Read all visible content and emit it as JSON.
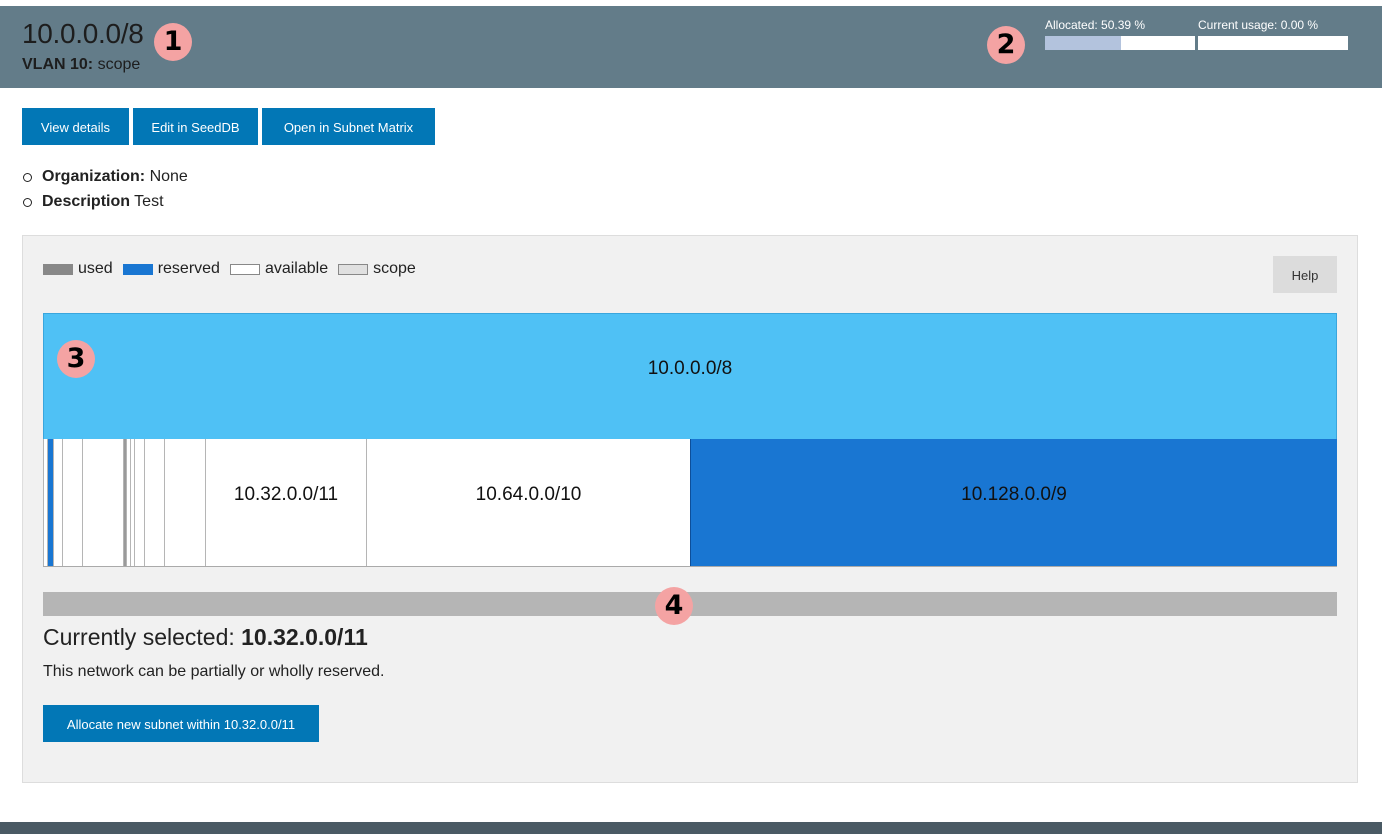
{
  "header": {
    "title": "10.0.0.0/8",
    "vlan_label": "VLAN 10:",
    "vlan_value": "scope",
    "allocated_label": "Allocated: 50.39 %",
    "allocated_fraction": 0.5039,
    "usage_label": "Current usage: 0.00 %",
    "usage_fraction": 0.0,
    "allocated_color": "#b3c3dd",
    "header_color": "#637c89"
  },
  "markers": [
    "1",
    "2",
    "3",
    "4"
  ],
  "actions": {
    "view_details": "View details",
    "edit_seeddb": "Edit in SeedDB",
    "open_matrix": "Open in Subnet Matrix"
  },
  "info": {
    "org_label": "Organization:",
    "org_value": "None",
    "desc_label": "Description",
    "desc_value": "Test"
  },
  "legend": {
    "used": "used",
    "reserved": "reserved",
    "available": "available",
    "scope": "scope",
    "colors": {
      "used": "#888888",
      "reserved": "#1976d2",
      "available": "#ffffff",
      "scope": "#e0e0e0"
    }
  },
  "help_label": "Help",
  "visualization": {
    "scope_label": "10.0.0.0/8",
    "scope_color": "#4fc1f5",
    "subnets": [
      {
        "label": "10.32.0.0/11",
        "status": "available"
      },
      {
        "label": "10.64.0.0/10",
        "status": "available"
      },
      {
        "label": "10.128.0.0/9",
        "status": "reserved"
      }
    ]
  },
  "selection": {
    "prefix_text": "Currently selected:",
    "selected": "10.32.0.0/11",
    "note": "This network can be partially or wholly reserved.",
    "allocate_button": "Allocate new subnet within 10.32.0.0/11"
  }
}
